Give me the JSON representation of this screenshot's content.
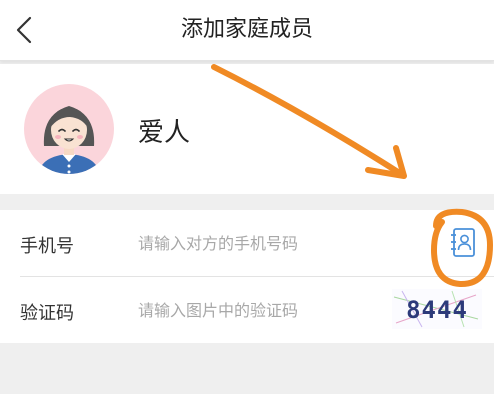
{
  "header": {
    "back_icon": "chevron-left-icon",
    "title": "添加家庭成员"
  },
  "profile": {
    "avatar_icon": "avatar-woman-icon",
    "name": "爱人"
  },
  "form": {
    "phone": {
      "label": "手机号",
      "placeholder": "请输入对方的手机号码",
      "value": "",
      "contact_icon": "contact-book-icon"
    },
    "captcha": {
      "label": "验证码",
      "placeholder": "请输入图片中的验证码",
      "value": "",
      "image_text": "8444"
    }
  },
  "colors": {
    "background": "#efefef",
    "surface": "#ffffff",
    "icon_blue": "#4a90d9",
    "annotation_orange": "#f08a24",
    "avatar_bg": "#fbd5db"
  }
}
